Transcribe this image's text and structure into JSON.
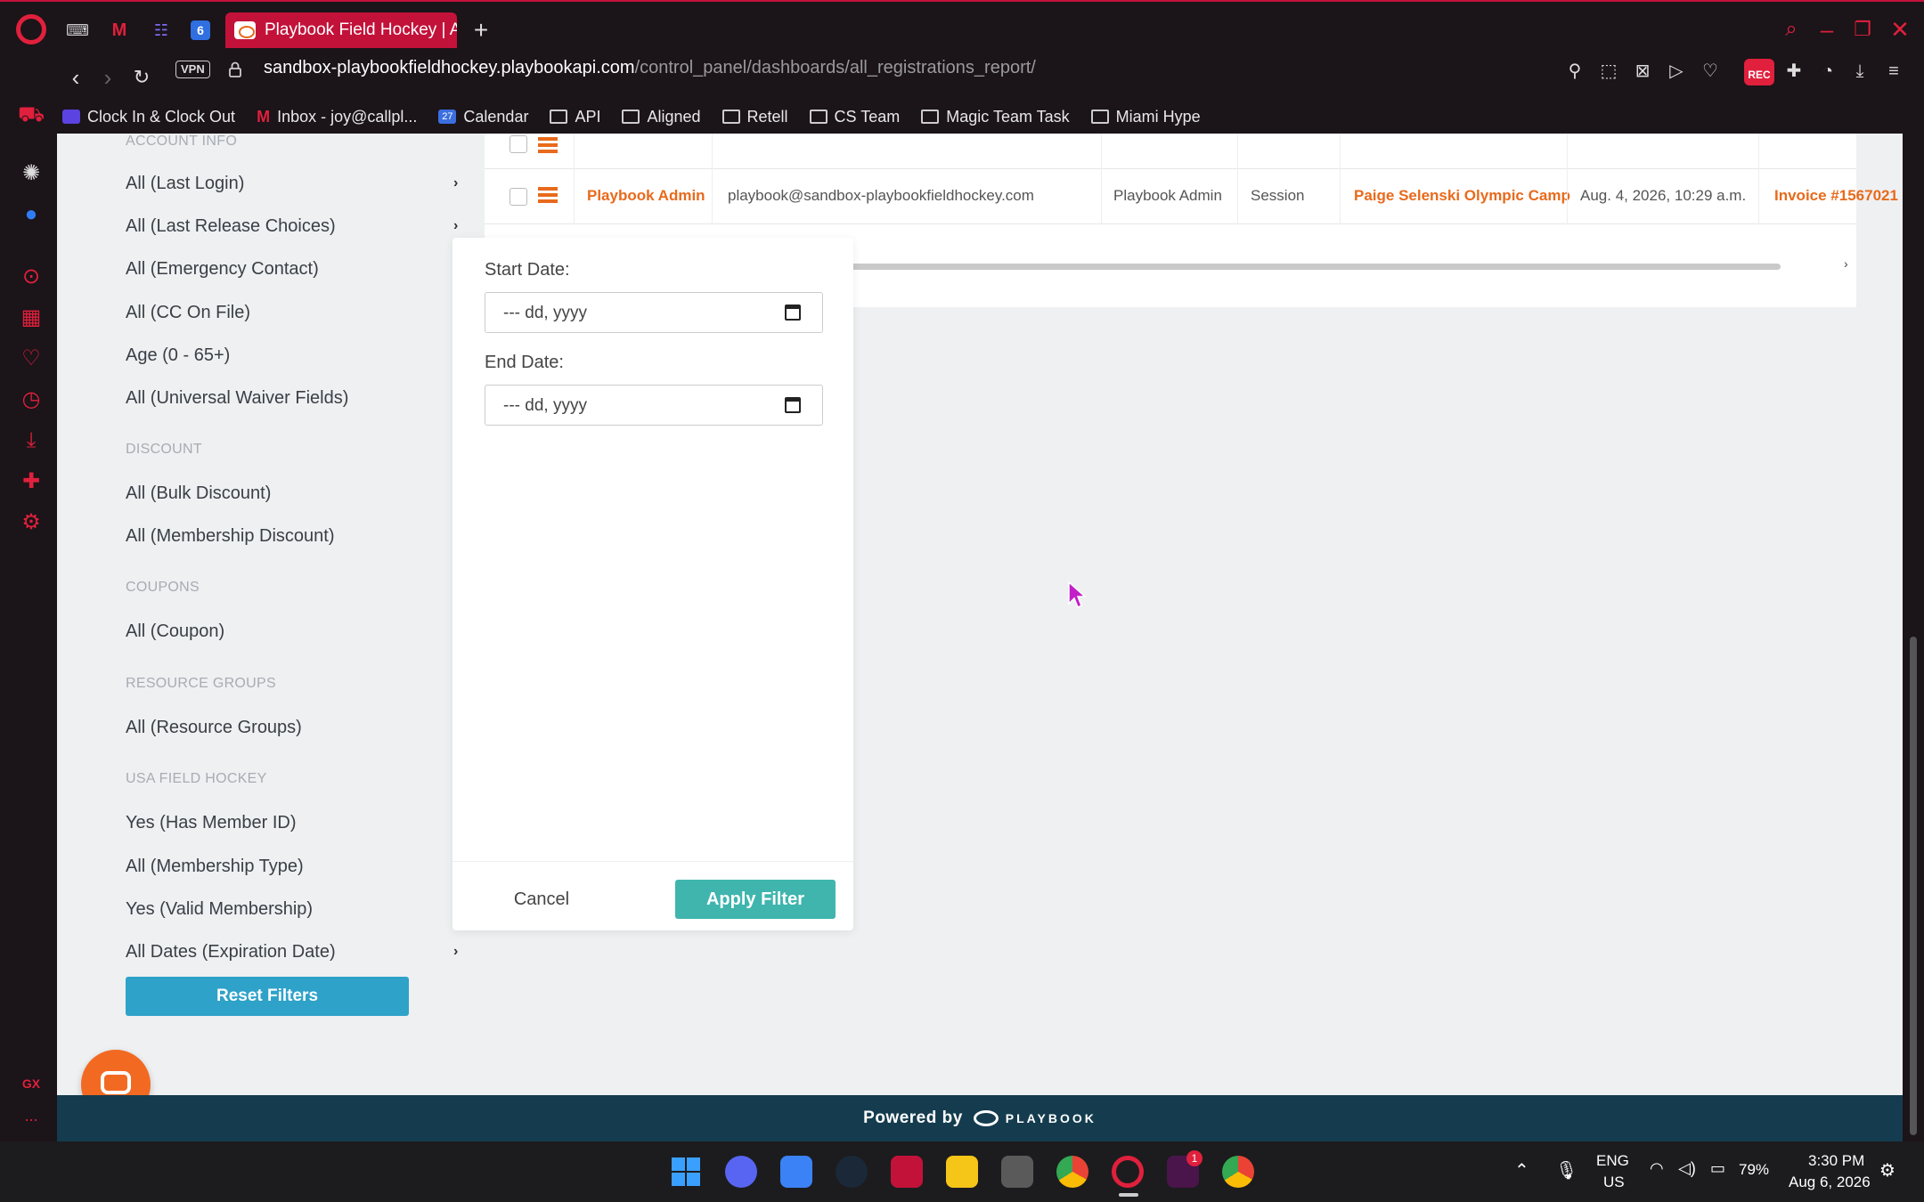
{
  "browser": {
    "active_tab_title": "Playbook Field Hockey | All",
    "url_host": "sandbox-playbookfieldhockey.playbookapi.com",
    "url_path": "/control_panel/dashboards/all_registrations_report/",
    "url_prefix": "",
    "vpn_label": "VPN",
    "rec_label": "REC",
    "tab_badge": "6",
    "sidebar_label_gx": "GX",
    "sidebar_label_more": "...",
    "bookmarks": [
      {
        "label": "Clock In & Clock Out",
        "icon": "clockin-icon"
      },
      {
        "label": "Inbox - joy@callpl...",
        "icon": "gmail-icon"
      },
      {
        "label": "Calendar",
        "icon": "calendar-icon"
      },
      {
        "label": "API",
        "icon": "folder-icon"
      },
      {
        "label": "Aligned",
        "icon": "folder-icon"
      },
      {
        "label": "Retell",
        "icon": "folder-icon"
      },
      {
        "label": "CS Team",
        "icon": "folder-icon"
      },
      {
        "label": "Magic Team Task",
        "icon": "folder-icon"
      },
      {
        "label": "Miami Hype",
        "icon": "folder-icon"
      }
    ],
    "calendar_badge": "27"
  },
  "filters": {
    "sections": {
      "account_info": "ACCOUNT INFO",
      "discount": "DISCOUNT",
      "coupons": "COUPONS",
      "resource_groups": "RESOURCE GROUPS",
      "usa_field_hockey": "USA FIELD HOCKEY"
    },
    "items": {
      "last_login": "All (Last Login)",
      "last_release": "All (Last Release Choices)",
      "emergency": "All (Emergency Contact)",
      "cc_on_file": "All (CC On File)",
      "age": "Age (0 - 65+)",
      "waiver": "All (Universal Waiver Fields)",
      "bulk_discount": "All (Bulk Discount)",
      "membership_discount": "All (Membership Discount)",
      "coupon": "All (Coupon)",
      "resource_groups": "All (Resource Groups)",
      "member_id": "Yes (Has Member ID)",
      "membership_type": "All (Membership Type)",
      "valid_membership": "Yes (Valid Membership)",
      "expiration_date": "All Dates (Expiration Date)"
    },
    "reset_label": "Reset Filters"
  },
  "table": {
    "row": {
      "name": "Playbook Admin",
      "email": "playbook@sandbox-playbookfieldhockey.com",
      "role": "Playbook Admin",
      "type": "Session",
      "program": "Paige Selenski Olympic Camp",
      "date": "Aug. 4, 2026, 10:29 a.m.",
      "invoice": "Invoice #1567021"
    }
  },
  "date_filter": {
    "start_label": "Start Date:",
    "end_label": "End Date:",
    "start_placeholder": "--- dd, yyyy",
    "end_placeholder": "--- dd, yyyy",
    "cancel_label": "Cancel",
    "apply_label": "Apply Filter"
  },
  "footer": {
    "powered_by": "Powered by",
    "brand": "PLAYBOOK"
  },
  "taskbar": {
    "language": "ENG",
    "region": "US",
    "battery": "79%",
    "time": "3:30 PM",
    "date": "Aug 6, 2026",
    "slack_badge": "1"
  },
  "colors": {
    "accent_red": "#c3123a",
    "link_orange": "#e86a1c",
    "apply_teal": "#3fb5ae",
    "reset_blue": "#2ea2c9",
    "footer_navy": "#143c4e"
  }
}
